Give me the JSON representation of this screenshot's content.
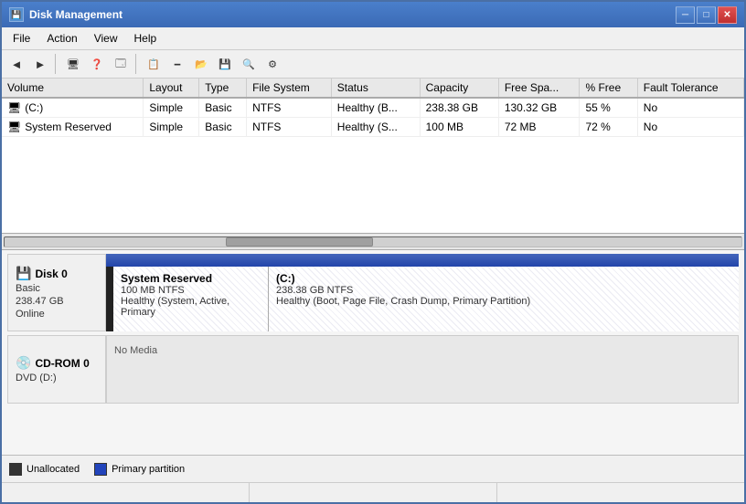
{
  "window": {
    "title": "Disk Management",
    "controls": {
      "minimize": "─",
      "maximize": "□",
      "close": "✕"
    }
  },
  "menu": {
    "items": [
      "File",
      "Action",
      "View",
      "Help"
    ]
  },
  "toolbar": {
    "buttons": [
      "◄",
      "►",
      "🗔",
      "?",
      "🗔",
      "📋",
      "🗕",
      "📂",
      "💾",
      "🔍",
      "⚙"
    ]
  },
  "table": {
    "columns": [
      "Volume",
      "Layout",
      "Type",
      "File System",
      "Status",
      "Capacity",
      "Free Spa...",
      "% Free",
      "Fault Tolerance"
    ],
    "rows": [
      {
        "volume": "(C:)",
        "layout": "Simple",
        "type": "Basic",
        "fs": "NTFS",
        "status": "Healthy (B...",
        "capacity": "238.38 GB",
        "free_space": "130.32 GB",
        "pct_free": "55 %",
        "fault_tolerance": "No"
      },
      {
        "volume": "System Reserved",
        "layout": "Simple",
        "type": "Basic",
        "fs": "NTFS",
        "status": "Healthy (S...",
        "capacity": "100 MB",
        "free_space": "72 MB",
        "pct_free": "72 %",
        "fault_tolerance": "No"
      }
    ]
  },
  "disks": [
    {
      "name": "Disk 0",
      "type": "Basic",
      "size": "238.47 GB",
      "status": "Online",
      "partitions": [
        {
          "label": "System Reserved",
          "size": "100 MB NTFS",
          "status": "Healthy (System, Active, Primary",
          "type": "primary"
        },
        {
          "label": "(C:)",
          "size": "238.38 GB NTFS",
          "status": "Healthy (Boot, Page File, Crash Dump, Primary Partition)",
          "type": "primary"
        }
      ]
    },
    {
      "name": "CD-ROM 0",
      "type": "DVD (D:)",
      "size": "",
      "status": "",
      "no_media": "No Media"
    }
  ],
  "legend": {
    "items": [
      {
        "label": "Unallocated",
        "color_class": "legend-unalloc"
      },
      {
        "label": "Primary partition",
        "color_class": "legend-primary"
      }
    ]
  },
  "status": {
    "panes": [
      "",
      "",
      ""
    ]
  }
}
